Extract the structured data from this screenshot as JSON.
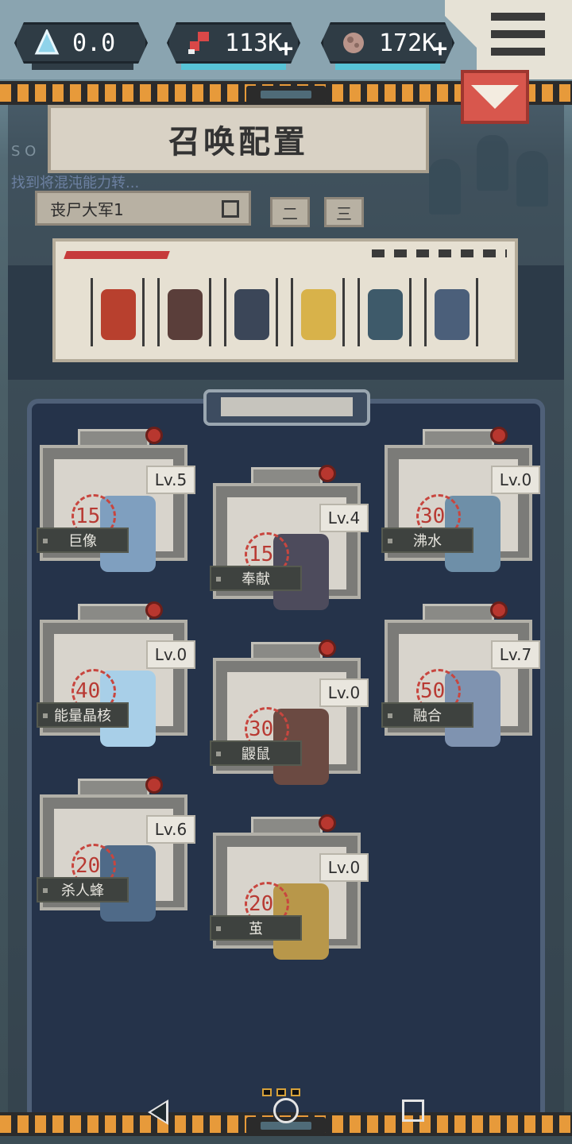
{
  "resources": [
    {
      "icon": "crystal-icon",
      "value": "0.0",
      "has_plus": false
    },
    {
      "icon": "meat-icon",
      "value": "113K",
      "has_plus": true
    },
    {
      "icon": "stone-icon",
      "value": "172K",
      "has_plus": true
    }
  ],
  "panel": {
    "title": "召唤配置",
    "faded_line_1": "S O",
    "faded_line_2": "找到将混沌能力转..."
  },
  "army": {
    "name": "丧尸大军1",
    "tabs": [
      "二",
      "三"
    ]
  },
  "formation_colors": [
    "#b8402e",
    "#5a3e3a",
    "#3b4658",
    "#d8b24a",
    "#3e5a6a",
    "#4b5f7a"
  ],
  "units": [
    {
      "name": "巨像",
      "cost": "15",
      "level": "Lv.5",
      "color": "#7f9fbf"
    },
    {
      "name": "奉献",
      "cost": "15",
      "level": "Lv.4",
      "color": "#4d4b5c"
    },
    {
      "name": "沸水",
      "cost": "30",
      "level": "Lv.0",
      "color": "#6e8fa8"
    },
    {
      "name": "能量晶核",
      "cost": "40",
      "level": "Lv.0",
      "color": "#a8cfe8"
    },
    {
      "name": "鼹鼠",
      "cost": "30",
      "level": "Lv.0",
      "color": "#6b4a42"
    },
    {
      "name": "融合",
      "cost": "50",
      "level": "Lv.7",
      "color": "#7f93b0"
    },
    {
      "name": "杀人蜂",
      "cost": "20",
      "level": "Lv.6",
      "color": "#4f6a88"
    },
    {
      "name": "茧",
      "cost": "20",
      "level": "Lv.0",
      "color": "#b8974a"
    }
  ]
}
